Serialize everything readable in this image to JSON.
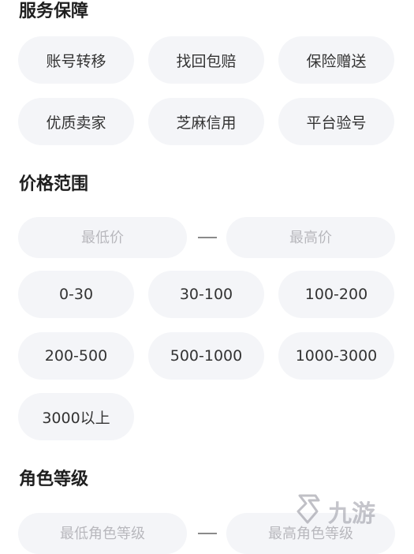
{
  "service": {
    "title": "服务保障",
    "options": [
      "账号转移",
      "找回包赔",
      "保险赠送",
      "优质卖家",
      "芝麻信用",
      "平台验号"
    ]
  },
  "price": {
    "title": "价格范围",
    "min_placeholder": "最低价",
    "max_placeholder": "最高价",
    "ranges": [
      "0-30",
      "30-100",
      "100-200",
      "200-500",
      "500-1000",
      "1000-3000",
      "3000以上"
    ]
  },
  "level": {
    "title": "角色等级",
    "min_placeholder": "最低角色等级",
    "max_placeholder": "最高角色等级"
  },
  "watermark": {
    "text": "九游",
    "icon": "jiuyou-logo-icon"
  }
}
